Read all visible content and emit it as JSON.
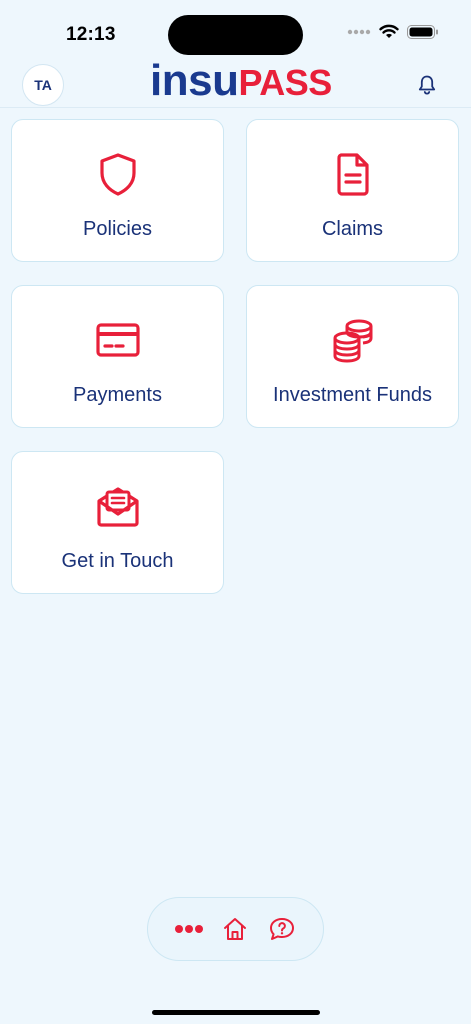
{
  "status_bar": {
    "time": "12:13"
  },
  "header": {
    "avatar_initials": "TA",
    "logo_part1": "insu",
    "logo_part2": "PASS"
  },
  "tiles": [
    {
      "label": "Policies",
      "icon": "shield-icon"
    },
    {
      "label": "Claims",
      "icon": "document-icon"
    },
    {
      "label": "Payments",
      "icon": "credit-card-icon"
    },
    {
      "label": "Investment Funds",
      "icon": "coins-stack-icon"
    },
    {
      "label": "Get in Touch",
      "icon": "envelope-letter-icon"
    }
  ],
  "bottom_nav": {
    "items": [
      {
        "icon": "more-dots-icon"
      },
      {
        "icon": "home-icon"
      },
      {
        "icon": "help-chat-icon"
      }
    ]
  },
  "colors": {
    "accent": "#e8203a",
    "brand_blue": "#1a3a8f",
    "text": "#1a3278",
    "background": "#eef7fd"
  }
}
